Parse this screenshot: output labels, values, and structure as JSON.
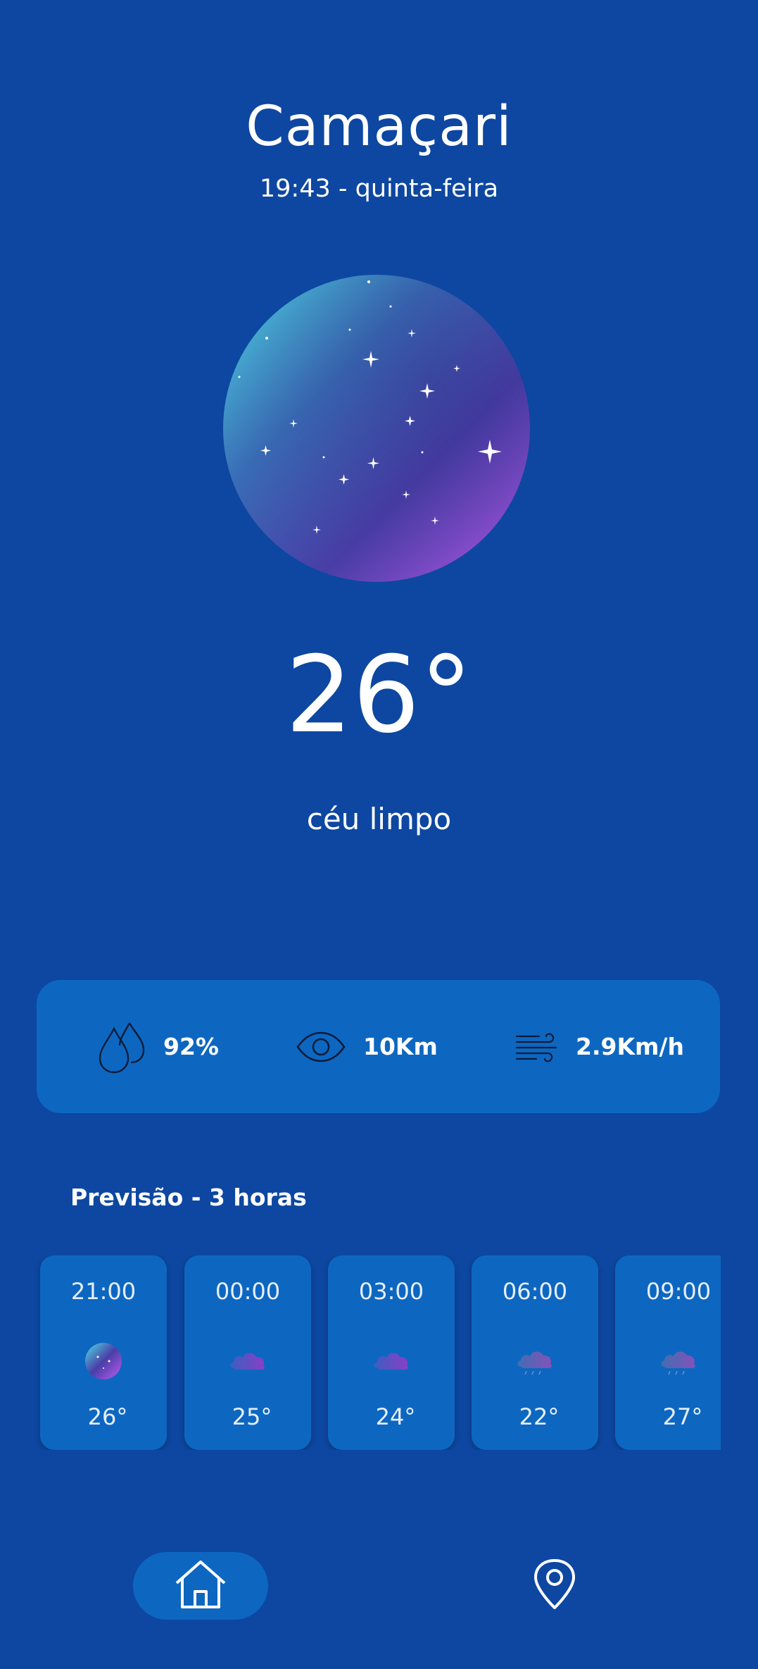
{
  "location": {
    "city": "Camaçari",
    "datetime": "19:43 - quinta-feira"
  },
  "current": {
    "temperature": "26°",
    "description": "céu limpo",
    "icon": "clear-night-orb"
  },
  "stats": {
    "humidity": {
      "icon": "droplets-icon",
      "value": "92%"
    },
    "visibility": {
      "icon": "eye-icon",
      "value": "10Km"
    },
    "wind": {
      "icon": "wind-icon",
      "value": "2.9Km/h"
    }
  },
  "forecast": {
    "title": "Previsão - 3 horas",
    "items": [
      {
        "time": "21:00",
        "temp": "26°",
        "icon": "clear-night-icon"
      },
      {
        "time": "00:00",
        "temp": "25°",
        "icon": "cloud-icon"
      },
      {
        "time": "03:00",
        "temp": "24°",
        "icon": "cloud-icon"
      },
      {
        "time": "06:00",
        "temp": "22°",
        "icon": "rain-cloud-icon"
      },
      {
        "time": "09:00",
        "temp": "27°",
        "icon": "rain-cloud-icon"
      }
    ]
  },
  "nav": {
    "home": "home-icon",
    "location": "map-pin-icon"
  },
  "colors": {
    "background": "#0d47a1",
    "card": "#0d67c0",
    "text": "#ffffff"
  }
}
